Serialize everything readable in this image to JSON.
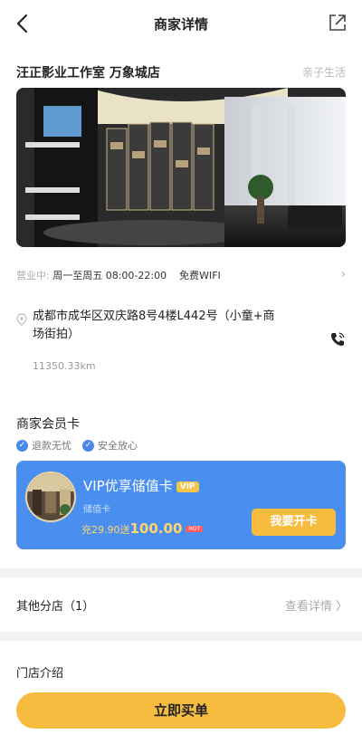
{
  "nav": {
    "title": "商家详情"
  },
  "store": {
    "name": "汪正影业工作室  万象城店",
    "category": "亲子生活"
  },
  "hours": {
    "status": "营业中:",
    "time": "周一至周五 08:00-22:00",
    "wifi": "免费WIFI"
  },
  "address": {
    "text": "成都市成华区双庆路8号4楼L442号（小童+商场街拍）",
    "distance": "11350.33km"
  },
  "member_card": {
    "section_title": "商家会员卡",
    "badges": [
      "退款无忧",
      "安全放心"
    ],
    "card_title": "VIP优享储值卡",
    "vip_tag": "VIP",
    "card_type": "储值卡",
    "offer_prefix": "充29.90送",
    "offer_amount": "100.00",
    "hot_tag": "HOT",
    "open_button": "我要开卡"
  },
  "branches": {
    "label": "其他分店（1）",
    "more": "查看详情 〉"
  },
  "intro": {
    "title": "门店介绍"
  },
  "buy_button": "立即买单",
  "colors": {
    "accent_yellow": "#f6bc3f",
    "card_blue": "#4a8ef0",
    "check_blue": "#4a88e8"
  }
}
